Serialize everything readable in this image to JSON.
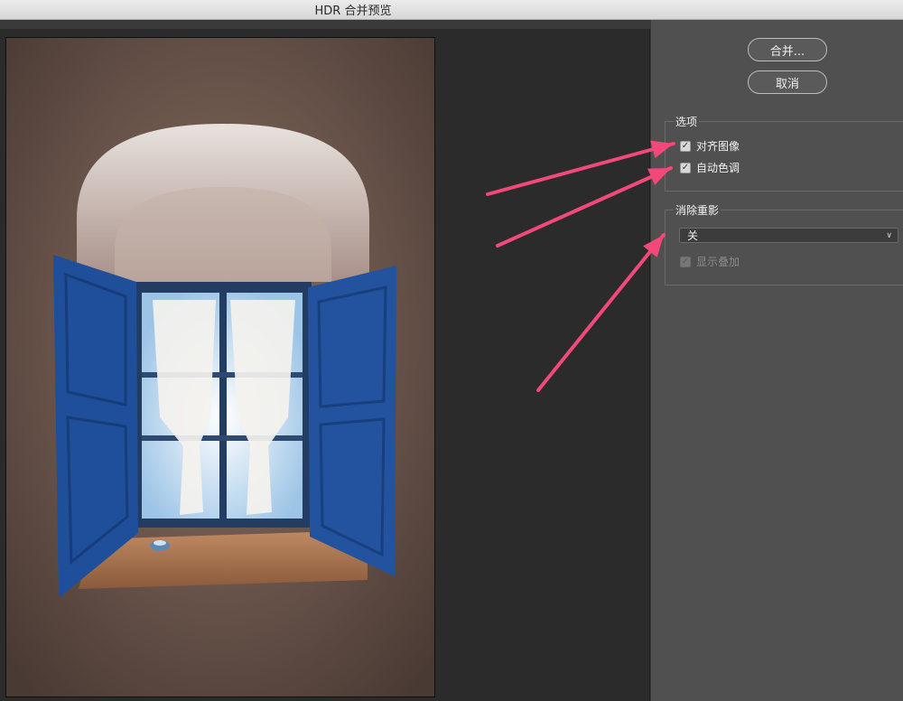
{
  "window": {
    "title": "HDR 合并预览"
  },
  "buttons": {
    "merge": "合并...",
    "cancel": "取消"
  },
  "options": {
    "label": "选项",
    "align_images": {
      "label": "对齐图像",
      "checked": true
    },
    "auto_tone": {
      "label": "自动色调",
      "checked": true
    }
  },
  "ghost_removal": {
    "label": "消除重影",
    "select_value": "关",
    "show_overlay": {
      "label": "显示叠加",
      "checked": true,
      "disabled": true
    }
  },
  "annotation": {
    "arrow_color": "#f2487a"
  },
  "colors": {
    "panel_bg": "#505050",
    "canvas_bg": "#2b2b2b"
  }
}
